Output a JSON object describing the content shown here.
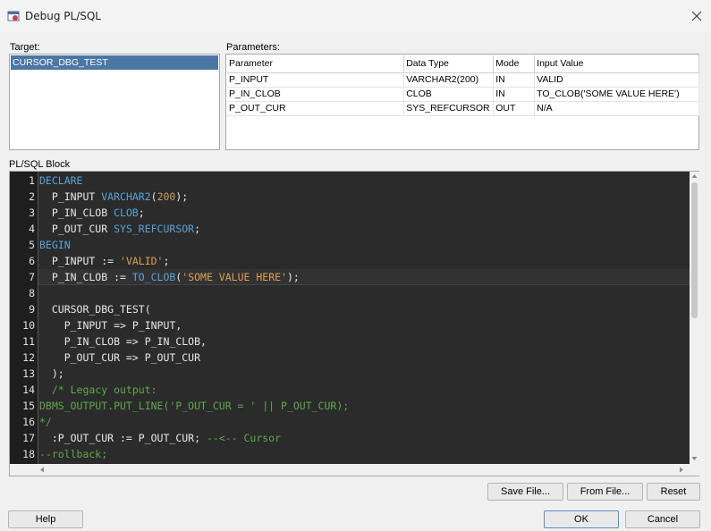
{
  "window": {
    "title": "Debug PL/SQL"
  },
  "target": {
    "label": "Target:",
    "items": [
      "CURSOR_DBG_TEST"
    ]
  },
  "parameters": {
    "label": "Parameters:",
    "columns": [
      "Parameter",
      "Data Type",
      "Mode",
      "Input Value"
    ],
    "rows": [
      [
        "P_INPUT",
        "VARCHAR2(200)",
        "IN",
        "VALID"
      ],
      [
        "P_IN_CLOB",
        "CLOB",
        "IN",
        "TO_CLOB('SOME VALUE HERE')"
      ],
      [
        "P_OUT_CUR",
        "SYS_REFCURSOR",
        "OUT",
        "N/A"
      ]
    ]
  },
  "plsql_block": {
    "label": "PL/SQL Block",
    "line_numbers": [
      "1",
      "2",
      "3",
      "4",
      "5",
      "6",
      "7",
      "8",
      "9",
      "10",
      "11",
      "12",
      "13",
      "14",
      "15",
      "16",
      "17",
      "18"
    ]
  },
  "buttons": {
    "save_file": "Save File...",
    "from_file": "From File...",
    "reset": "Reset",
    "help": "Help",
    "ok": "OK",
    "cancel": "Cancel"
  },
  "colors": {
    "selection": "#4b77a4",
    "editor_bg": "#2b2b2b",
    "keyword": "#5aa3d6",
    "string": "#d9a058",
    "comment": "#5fa84a"
  }
}
